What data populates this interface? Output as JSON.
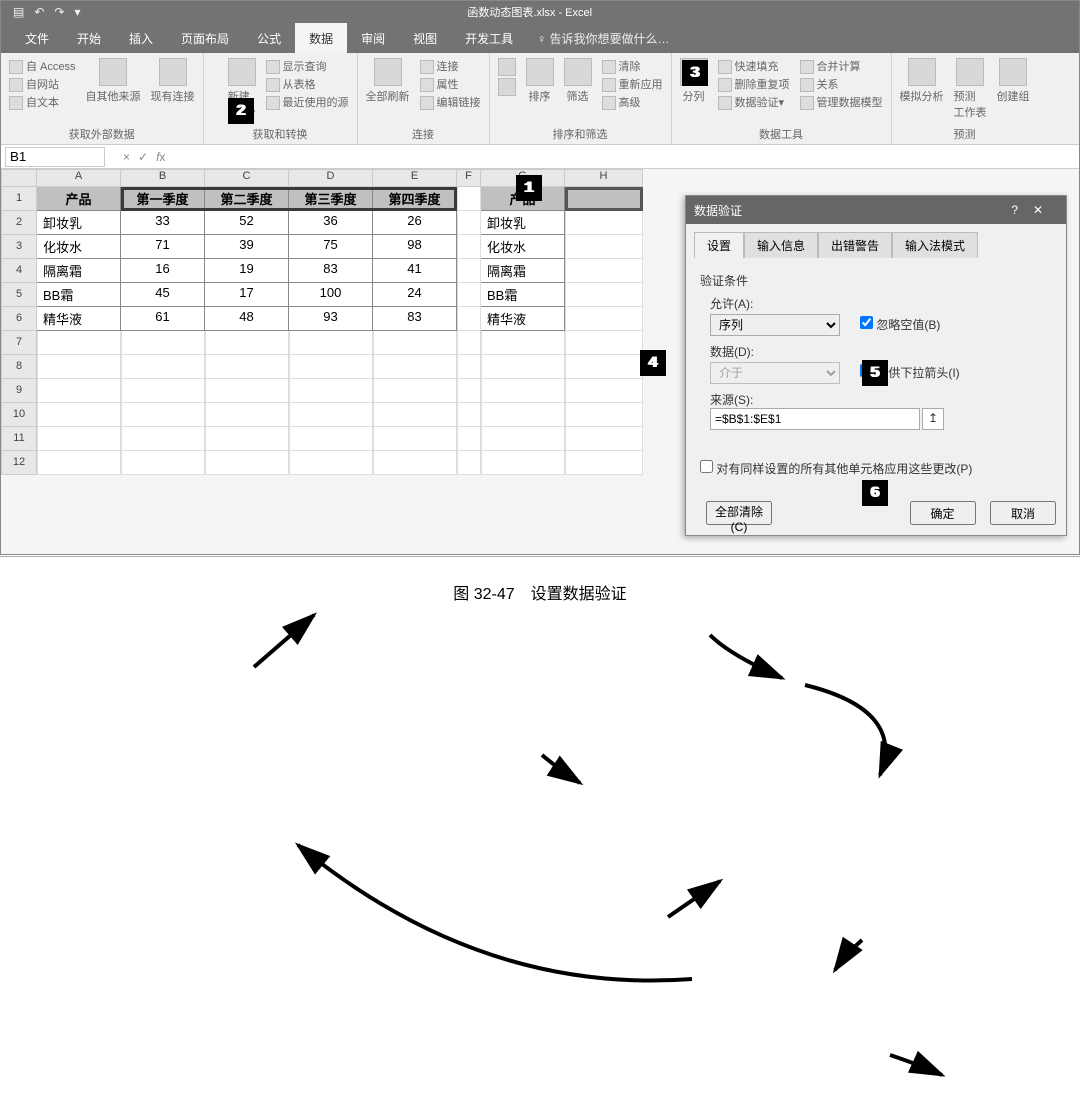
{
  "title": "函数动态图表.xlsx - Excel",
  "tabs": [
    "文件",
    "开始",
    "插入",
    "页面布局",
    "公式",
    "数据",
    "审阅",
    "视图",
    "开发工具"
  ],
  "active_tab": "数据",
  "tell_me": "告诉我你想要做什么…",
  "groups": {
    "g1": {
      "label": "获取外部数据",
      "i": [
        "自 Access",
        "自网站",
        "自文本",
        "自其他来源",
        "现有连接"
      ]
    },
    "g2": {
      "label": "获取和转换",
      "i": [
        "新建\n查询",
        "显示查询",
        "从表格",
        "最近使用的源"
      ]
    },
    "g3": {
      "label": "连接",
      "i": [
        "全部刷新",
        "连接",
        "属性",
        "编辑链接"
      ]
    },
    "g4": {
      "label": "排序和筛选",
      "i": [
        "排序",
        "筛选",
        "清除",
        "重新应用",
        "高级"
      ]
    },
    "g5": {
      "label": "数据工具",
      "i": [
        "分列",
        "快速填充",
        "删除重复项",
        "数据验证",
        "合并计算",
        "关系",
        "管理数据模型"
      ]
    },
    "g6": {
      "label": "预测",
      "i": [
        "模拟分析",
        "预测\n工作表",
        "创建组"
      ]
    }
  },
  "namebox": "B1",
  "cols": [
    "A",
    "B",
    "C",
    "D",
    "E",
    "F",
    "G",
    "H"
  ],
  "table": {
    "header": [
      "产品",
      "第一季度",
      "第二季度",
      "第三季度",
      "第四季度"
    ],
    "rows": [
      [
        "卸妆乳",
        "33",
        "52",
        "36",
        "26"
      ],
      [
        "化妆水",
        "71",
        "39",
        "75",
        "98"
      ],
      [
        "隔离霜",
        "16",
        "19",
        "83",
        "41"
      ],
      [
        "BB霜",
        "45",
        "17",
        "100",
        "24"
      ],
      [
        "精华液",
        "61",
        "48",
        "93",
        "83"
      ]
    ],
    "header2": "产品",
    "prods2": [
      "卸妆乳",
      "化妆水",
      "隔离霜",
      "BB霜",
      "精华液"
    ]
  },
  "dialog": {
    "title": "数据验证",
    "tabs": [
      "设置",
      "输入信息",
      "出错警告",
      "输入法模式"
    ],
    "cond": "验证条件",
    "allow_lbl": "允许(A):",
    "allow": "序列",
    "data_lbl": "数据(D):",
    "data": "介于",
    "src_lbl": "来源(S):",
    "src": "=$B$1:$E$1",
    "ignore": "忽略空值(B)",
    "dropdown": "提供下拉箭头(I)",
    "applyall": "对有同样设置的所有其他单元格应用这些更改(P)",
    "clear": "全部清除(C)",
    "ok": "确定",
    "cancel": "取消"
  },
  "caption": {
    "num": "图 32-47",
    "text": "设置数据验证"
  }
}
